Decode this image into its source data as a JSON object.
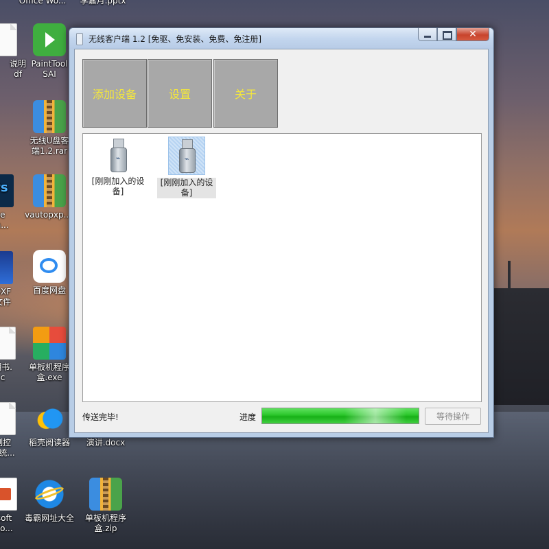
{
  "desktop": {
    "icons": [
      {
        "label": "Office Wo...",
        "icon": "word-file-icon"
      },
      {
        "label": "李嘉月.pptx",
        "icon": "pptx-file-icon"
      },
      {
        "label": "说明",
        "label2": "df",
        "icon": "pdf-file-icon"
      },
      {
        "label": "PaintTool",
        "label2": "SAI",
        "icon": "painttool-sai-icon"
      },
      {
        "label": "无线U盘客",
        "label2": "端1.2.rar",
        "icon": "rar-archive-icon"
      },
      {
        "label": "be",
        "label2": "sh...",
        "icon": "photoshop-icon"
      },
      {
        "label": "vautopxp....",
        "icon": "rar-archive-icon"
      },
      {
        "label": "DXF",
        "label2": "文件",
        "icon": "dxf-app-icon"
      },
      {
        "label": "百度网盘",
        "icon": "baidu-netdisk-icon"
      },
      {
        "label": "明书.",
        "label2": "c",
        "icon": "doc-file-icon"
      },
      {
        "label": "单板机程序",
        "label2": "盒.exe",
        "icon": "office-app-icon"
      },
      {
        "label": "制控",
        "label2": "系统...",
        "icon": "doc-file-icon"
      },
      {
        "label": "稻壳阅读器",
        "icon": "docer-reader-icon"
      },
      {
        "label": "演讲.docx",
        "icon": "docx-file-icon"
      },
      {
        "label": "soft",
        "label2": "Po...",
        "icon": "powerpoint-icon"
      },
      {
        "label": "毒霸网址大全",
        "icon": "ie-browser-icon"
      },
      {
        "label": "单板机程序",
        "label2": "盒.zip",
        "icon": "zip-archive-icon"
      }
    ]
  },
  "window": {
    "title": "无线客户端 1.2 [免驱、免安装、免费、免注册]",
    "controls": {
      "minimize": "",
      "maximize": "",
      "close": "✕"
    },
    "toolbar": {
      "add_device": "添加设备",
      "settings": "设置",
      "about": "关于"
    },
    "devices": [
      {
        "label": "[刚刚加入的设备]",
        "selected": false
      },
      {
        "label": "[刚刚加入的设备]",
        "selected": true
      }
    ],
    "status": {
      "message": "传送完毕!",
      "progress_label": "进度",
      "progress_percent": 100,
      "wait_button": "等待操作"
    }
  }
}
